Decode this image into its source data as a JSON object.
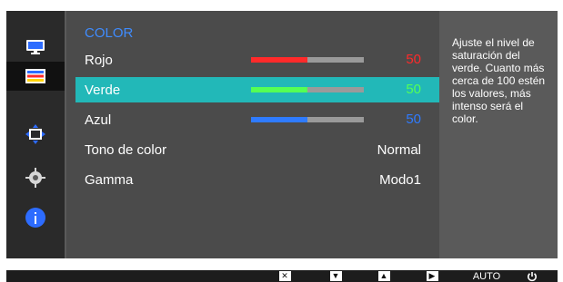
{
  "menu": {
    "title": "COLOR",
    "rows": [
      {
        "label": "Rojo",
        "value": "50",
        "value_color": "#ff2a2a",
        "fill_percent": 50,
        "fill_color": "#ff2a2a"
      },
      {
        "label": "Verde",
        "value": "50",
        "value_color": "#55ff55",
        "fill_percent": 50,
        "fill_color": "#55ff55"
      },
      {
        "label": "Azul",
        "value": "50",
        "value_color": "#2f7bff",
        "fill_percent": 50,
        "fill_color": "#2f7bff"
      },
      {
        "label": "Tono de color",
        "value": "Normal"
      },
      {
        "label": "Gamma",
        "value": "Modo1"
      }
    ],
    "selected_row": "Verde"
  },
  "help": {
    "text": "Ajuste el nivel de saturación del verde. Cuanto más cerca de 100 estén los valores, más intenso será el color."
  },
  "bottom": {
    "auto_label": "AUTO"
  },
  "icons": {
    "sidebar": [
      "monitor-icon",
      "color-bars-icon",
      "resize-icon",
      "gear-icon",
      "info-icon"
    ],
    "bottom": [
      "close-icon",
      "down-arrow-icon",
      "up-arrow-icon",
      "right-arrow-icon",
      "power-icon"
    ]
  },
  "colors": {
    "selected_row": "#22b8b8",
    "title": "#3f8cff",
    "panel": "#4b4b4b",
    "sidebar": "#2a2a2a"
  }
}
